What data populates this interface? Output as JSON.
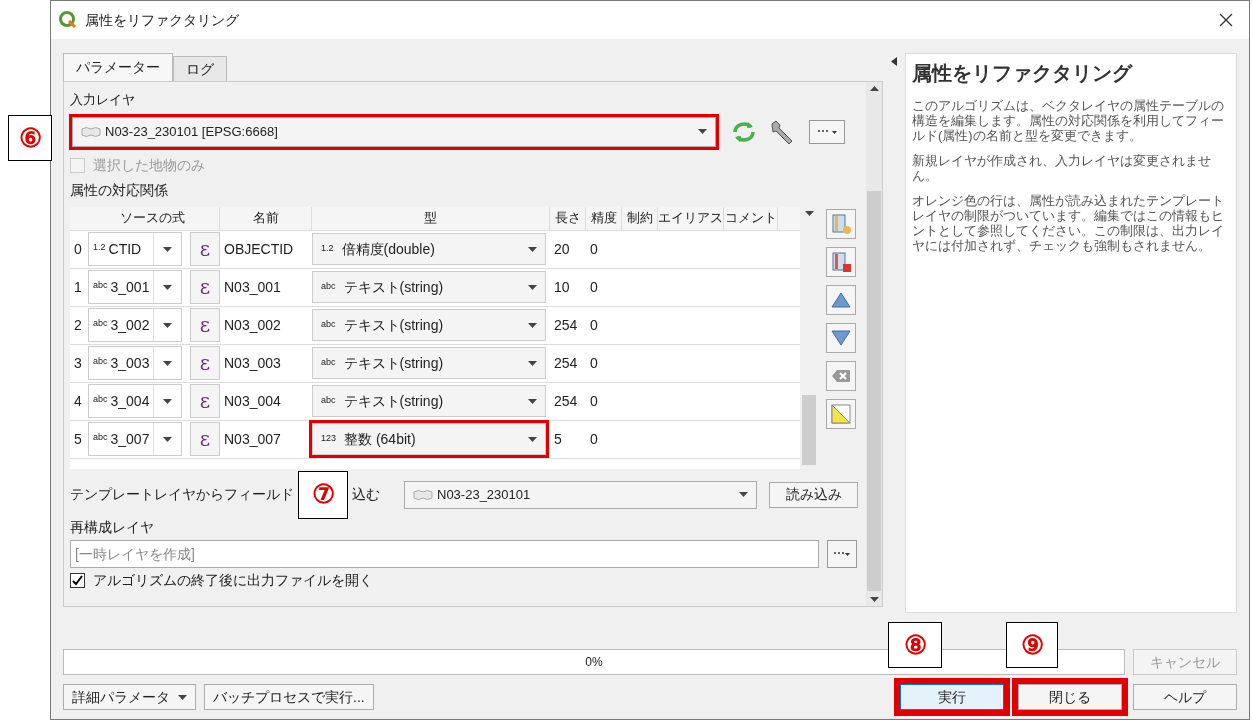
{
  "window": {
    "title": "属性をリファクタリング"
  },
  "tabs": [
    {
      "label": "パラメーター",
      "selected": true
    },
    {
      "label": "ログ",
      "selected": false
    }
  ],
  "input_layer": {
    "label": "入力レイヤ",
    "value": "N03-23_230101 [EPSG:6668]",
    "highlighted": true
  },
  "selected_only": {
    "label": "選択した地物のみ",
    "checked": false,
    "disabled": true
  },
  "mapping": {
    "label": "属性の対応関係",
    "columns": [
      "ソースの式",
      "名前",
      "型",
      "長さ",
      "精度",
      "制約",
      "エイリアス",
      "コメント"
    ],
    "rows": [
      {
        "index": "0",
        "source_icon": "1.2",
        "source": "CTID",
        "expression": "ε",
        "name": "OBJECTID",
        "type_icon": "1.2",
        "type": "倍精度(double)",
        "length": "20",
        "precision": "0",
        "highlighted": false
      },
      {
        "index": "1",
        "source_icon": "abc",
        "source": "3_001",
        "expression": "ε",
        "name": "N03_001",
        "type_icon": "abc",
        "type": "テキスト(string)",
        "length": "10",
        "precision": "0",
        "highlighted": false
      },
      {
        "index": "2",
        "source_icon": "abc",
        "source": "3_002",
        "expression": "ε",
        "name": "N03_002",
        "type_icon": "abc",
        "type": "テキスト(string)",
        "length": "254",
        "precision": "0",
        "highlighted": false
      },
      {
        "index": "3",
        "source_icon": "abc",
        "source": "3_003",
        "expression": "ε",
        "name": "N03_003",
        "type_icon": "abc",
        "type": "テキスト(string)",
        "length": "254",
        "precision": "0",
        "highlighted": false
      },
      {
        "index": "4",
        "source_icon": "abc",
        "source": "3_004",
        "expression": "ε",
        "name": "N03_004",
        "type_icon": "abc",
        "type": "テキスト(string)",
        "length": "254",
        "precision": "0",
        "highlighted": false
      },
      {
        "index": "5",
        "source_icon": "abc",
        "source": "3_007",
        "expression": "ε",
        "name": "N03_007",
        "type_icon": "123",
        "type": "整数 (64bit)",
        "length": "5",
        "precision": "0",
        "highlighted": true
      }
    ]
  },
  "template": {
    "label_start": "テンプレートレイヤからフィールド",
    "label_end": "込む",
    "value": "N03-23_230101",
    "button": "読み込み"
  },
  "output": {
    "label": "再構成レイヤ",
    "placeholder": "[一時レイヤを作成]"
  },
  "open_after": {
    "label": "アルゴリズムの終了後に出力ファイルを開く",
    "checked": true
  },
  "help": {
    "title": "属性をリファクタリング",
    "paragraphs": [
      "このアルゴリズムは、ベクタレイヤの属性テーブルの構造を編集します。属性の対応関係を利用してフィールド(属性)の名前と型を変更できます。",
      "新規レイヤが作成され、入力レイヤは変更されません。",
      "オレンジ色の行は、属性が読み込まれたテンプレートレイヤの制限がついています。編集ではこの情報もヒントとして参照してください。この制限は、出力レイヤには付加されず、チェックも強制もされません。"
    ]
  },
  "progress": {
    "level": 0,
    "text": "0%",
    "cancel": "キャンセル"
  },
  "buttons": [
    {
      "label": "詳細パラメータ",
      "kind": "menu",
      "highlighted": false
    },
    {
      "label": "バッチプロセスで実行...",
      "kind": "plain",
      "highlighted": false
    },
    {
      "label": "実行",
      "kind": "primary",
      "highlighted": true
    },
    {
      "label": "閉じる",
      "kind": "plain",
      "highlighted": true
    },
    {
      "label": "ヘルプ",
      "kind": "plain",
      "highlighted": false
    }
  ],
  "callouts": [
    "⑥",
    "⑦",
    "⑧",
    "⑨"
  ]
}
